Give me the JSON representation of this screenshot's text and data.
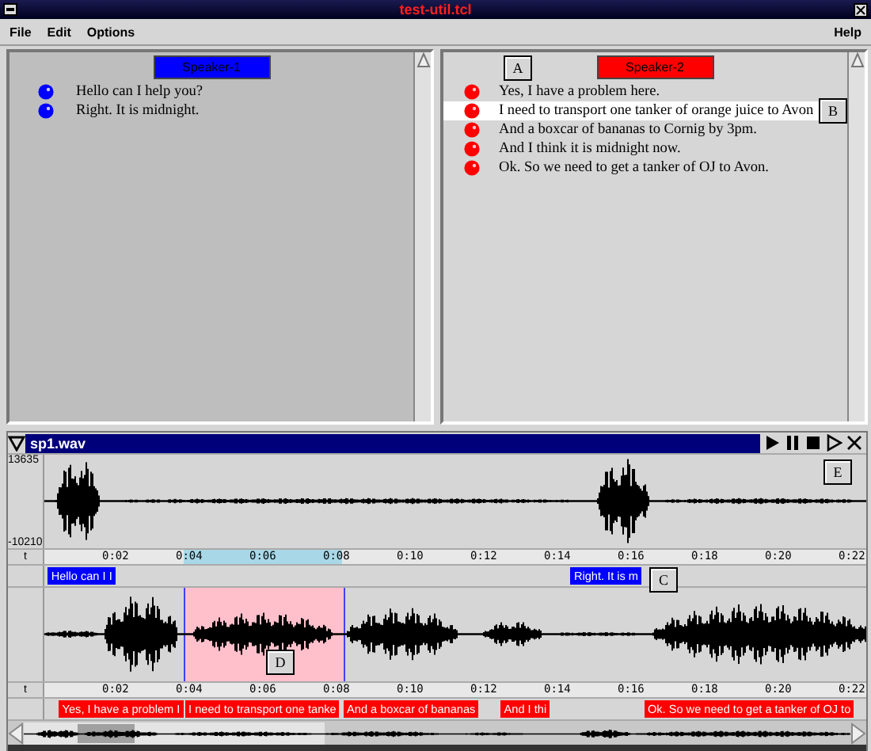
{
  "window": {
    "title": "test-util.tcl"
  },
  "menu": {
    "items": [
      {
        "label": "File"
      },
      {
        "label": "Edit"
      },
      {
        "label": "Options"
      }
    ],
    "help": "Help"
  },
  "panes": [
    {
      "speaker": "Speaker-1",
      "color": "#0000ff",
      "lines": [
        {
          "text": "Hello can I help you?",
          "selected": false
        },
        {
          "text": "Right. It is midnight.",
          "selected": false
        }
      ]
    },
    {
      "speaker": "Speaker-2",
      "color": "#ff0000",
      "lines": [
        {
          "text": "Yes, I have a problem here.",
          "selected": false
        },
        {
          "text": "I need to transport one tanker of orange juice to Avon",
          "selected": true
        },
        {
          "text": "And a boxcar of bananas to Cornig by 3pm.",
          "selected": false
        },
        {
          "text": "And I think it is midnight now.",
          "selected": false
        },
        {
          "text": "Ok. So we need to get a tanker of OJ to Avon.",
          "selected": false
        }
      ]
    }
  ],
  "callouts": [
    {
      "label": "A"
    },
    {
      "label": "B"
    },
    {
      "label": "C"
    },
    {
      "label": "D"
    },
    {
      "label": "E"
    }
  ],
  "audio": {
    "file": "sp1.wav",
    "scale_max": "13635",
    "scale_min": "-10210",
    "axes": [
      {
        "label": "t",
        "ticks": [
          "0:02",
          "0:04",
          "0:06",
          "0:08",
          "0:10",
          "0:12",
          "0:14",
          "0:16",
          "0:18",
          "0:20",
          "0:22"
        ]
      },
      {
        "label": "t",
        "ticks": [
          "0:02",
          "0:04",
          "0:06",
          "0:08",
          "0:10",
          "0:12",
          "0:14",
          "0:16",
          "0:18",
          "0:20",
          "0:22"
        ]
      }
    ],
    "tiers": [
      {
        "color": "#0000ff",
        "segments": [
          {
            "text": "Hello can I I"
          },
          {
            "text": "Right. It is m"
          }
        ]
      },
      {
        "color": "#ff0000",
        "segments": [
          {
            "text": "Yes, I have a problem I"
          },
          {
            "text": "I need to transport one tanke"
          },
          {
            "text": "And a boxcar of bananas"
          },
          {
            "text": "And I thi"
          },
          {
            "text": "Ok. So we need to get a tanker of OJ to"
          }
        ]
      }
    ]
  }
}
